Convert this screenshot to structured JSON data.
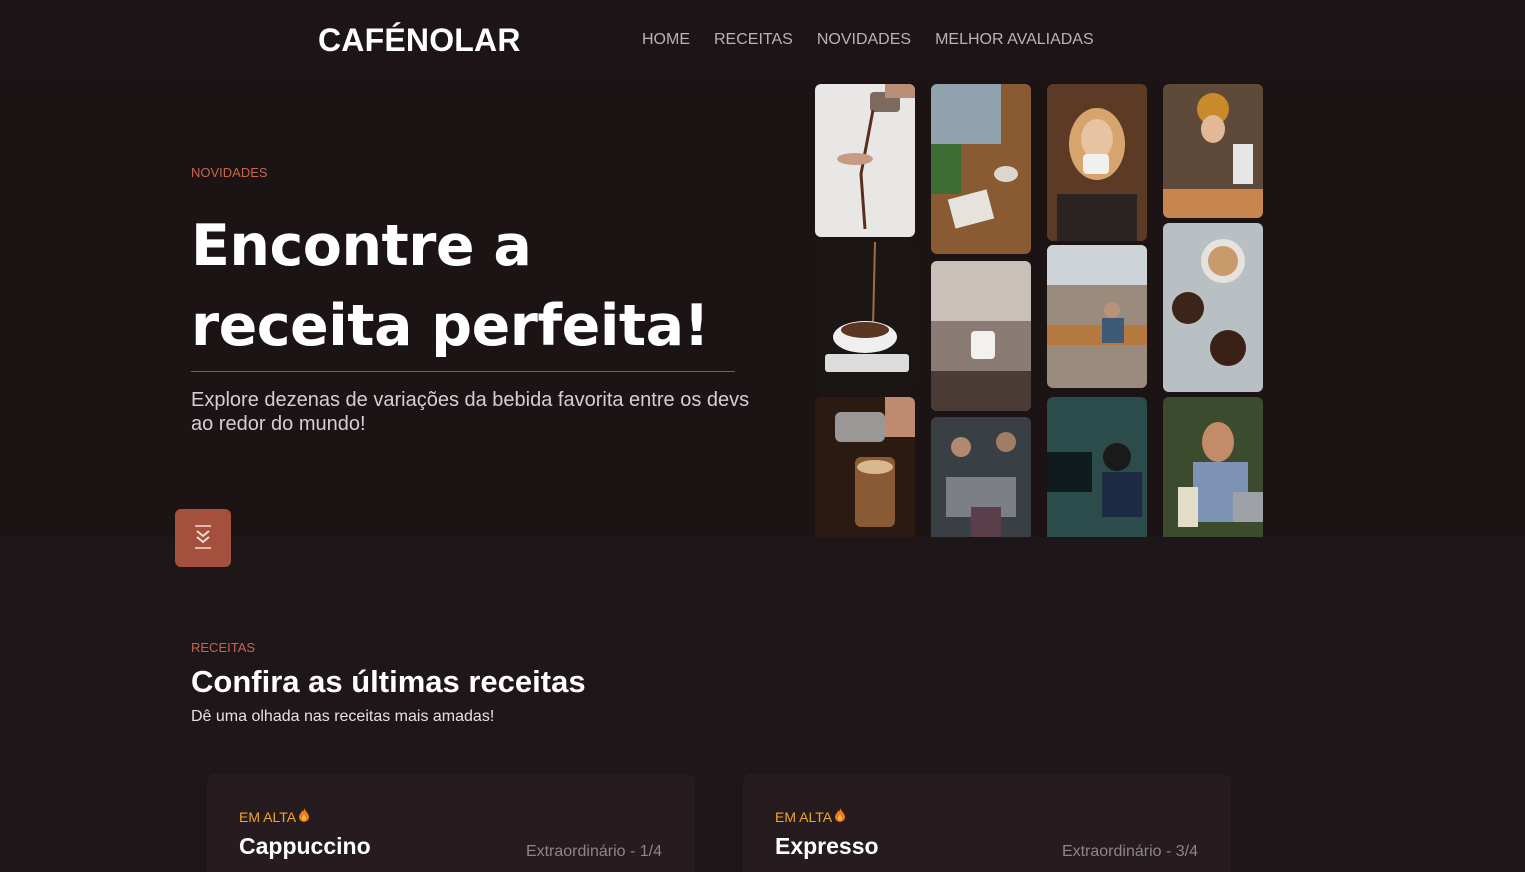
{
  "header": {
    "logo": "CAFÉNOLAR",
    "nav": [
      "HOME",
      "RECEITAS",
      "NOVIDADES",
      "MELHOR AVALIADAS"
    ]
  },
  "hero": {
    "eyebrow": "NOVIDADES",
    "title_line1": "Encontre a",
    "title_line2": "receita perfeita!",
    "subtitle": "Explore dezenas de variações da bebida favorita entre os devs ao redor do mundo!",
    "scroll_icon": "double-chevron-down-icon"
  },
  "gallery": {
    "photos": [
      "coffee-pour-photo",
      "coffee-pour-cup-photo",
      "latte-art-pour-photo",
      "cafe-table-photo",
      "coffee-mug-window-photo",
      "barista-team-photo",
      "woman-drinking-coffee-photo",
      "office-meeting-photo",
      "developer-coding-photo",
      "barista-woman-photo",
      "latte-beans-photo",
      "man-laptop-coffee-photo"
    ]
  },
  "receitas": {
    "eyebrow": "RECEITAS",
    "title": "Confira as últimas receitas",
    "subtitle": "Dê uma olhada nas receitas mais amadas!",
    "cards": [
      {
        "badge": "EM ALTA",
        "badge_icon": "fire-icon",
        "title": "Cappuccino",
        "rating": "Extraordinário - 1/4"
      },
      {
        "badge": "EM ALTA",
        "badge_icon": "fire-icon",
        "title": "Expresso",
        "rating": "Extraordinário - 3/4"
      }
    ]
  },
  "colors": {
    "background": "#1f1619",
    "accent": "#c5654f",
    "button": "#a54f3d",
    "badge": "#f0a62a"
  }
}
